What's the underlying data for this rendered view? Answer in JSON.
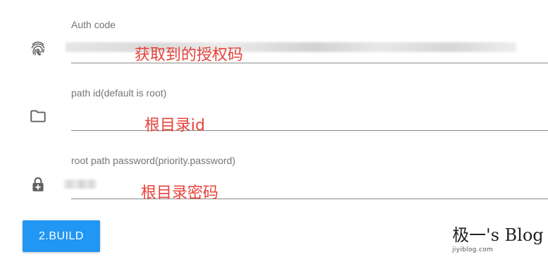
{
  "form": {
    "auth_code": {
      "label": "Auth code",
      "icon": "fingerprint-icon",
      "annotation": "获取到的授权码"
    },
    "path_id": {
      "label": "path id(default is root)",
      "icon": "folder-icon",
      "annotation": "根目录id"
    },
    "root_password": {
      "label": "root path password(priority.password)",
      "icon": "lock-plus-icon",
      "annotation": "根目录密码"
    }
  },
  "build_button": {
    "label": "2.BUILD",
    "color": "#2196f3"
  },
  "watermark": {
    "title": "极一's Blog",
    "url": "jiyiblog.com"
  },
  "colors": {
    "annotation": "#e8423a",
    "label": "#757575",
    "icon": "#616161"
  }
}
